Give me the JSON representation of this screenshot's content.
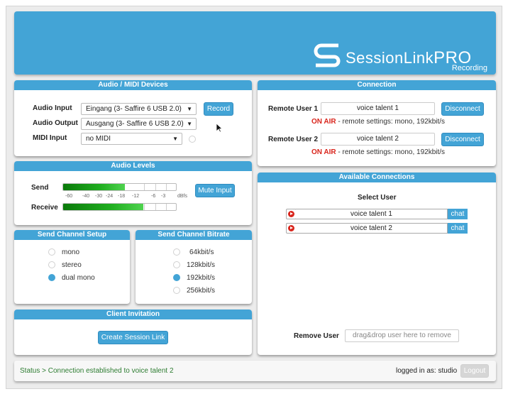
{
  "app": {
    "name": "SessionLinkPRO",
    "edition": "Recording",
    "name_prefix": "Session",
    "name_middle": "Link",
    "name_suffix": "PRO"
  },
  "devices": {
    "title": "Audio / MIDI Devices",
    "audio_input_label": "Audio Input",
    "audio_input_value": "Eingang (3- Saffire 6 USB 2.0)",
    "audio_output_label": "Audio Output",
    "audio_output_value": "Ausgang (3- Saffire 6 USB 2.0)",
    "midi_input_label": "MIDI Input",
    "midi_input_value": "no MIDI",
    "record_label": "Record"
  },
  "levels": {
    "title": "Audio Levels",
    "send_label": "Send",
    "receive_label": "Receive",
    "send_level": 0.55,
    "receive_level": 0.71,
    "scale": [
      "-60",
      "-40",
      "-30",
      "-24",
      "-18",
      "-12",
      "-6",
      "-3",
      "dBfs"
    ],
    "mute_label": "Mute Input"
  },
  "channel": {
    "title": "Send Channel Setup",
    "options": [
      "mono",
      "stereo",
      "dual mono"
    ],
    "selected": "dual mono"
  },
  "bitrate": {
    "title": "Send Channel Bitrate",
    "options": [
      "64kbit/s",
      "128kbit/s",
      "192kbit/s",
      "256kbit/s"
    ],
    "selected": "192kbit/s"
  },
  "invitation": {
    "title": "Client Invitation",
    "button_label": "Create Session Link"
  },
  "connection": {
    "title": "Connection",
    "remote1_label": "Remote User 1",
    "remote1_value": "voice talent 1",
    "remote1_on_air": "ON AIR",
    "remote1_settings": " - remote settings: mono, 192kbit/s",
    "remote2_label": "Remote User 2",
    "remote2_value": "voice talent 2",
    "remote2_on_air": "ON AIR",
    "remote2_settings": " - remote settings: mono, 192kbit/s",
    "disconnect_label": "Disconnect"
  },
  "available": {
    "title": "Available Connections",
    "select_user_label": "Select User",
    "users": [
      "voice talent 1",
      "voice talent 2"
    ],
    "chat_label": "chat",
    "remove_label": "Remove User",
    "remove_placeholder": "drag&drop user here to remove"
  },
  "status": {
    "text": "Status > Connection established to voice talent 2",
    "logged_in": "logged in as: studio",
    "logout_label": "Logout"
  },
  "colors": {
    "accent": "#43a4d6",
    "on_air": "#d9251c",
    "status_ok": "#2e7d32"
  }
}
